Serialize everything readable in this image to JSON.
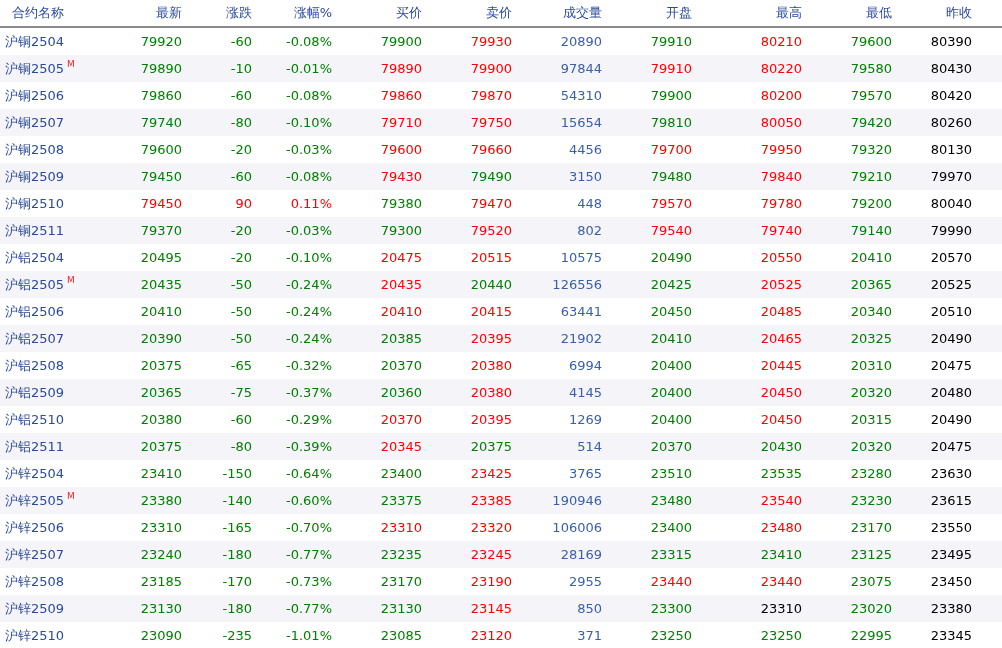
{
  "columns": [
    "合约名称",
    "最新",
    "涨跌",
    "涨幅%",
    "买价",
    "卖价",
    "成交量",
    "开盘",
    "最高",
    "最低",
    "昨收"
  ],
  "rows": [
    {
      "name": "沪铜2504",
      "cells": [
        {
          "text": "79920",
          "color": "#008000"
        },
        {
          "text": "-60",
          "color": "#008000"
        },
        {
          "text": "-0.08%",
          "color": "#008000"
        },
        {
          "text": "79900",
          "color": "#008000"
        },
        {
          "text": "79930",
          "color": "#ff0000"
        },
        {
          "text": "20890"
        },
        {
          "text": "79910",
          "color": "#008000"
        },
        {
          "text": "80210",
          "color": "#ff0000"
        },
        {
          "text": "79600",
          "color": "#008000"
        },
        {
          "text": "80390",
          "color": "#000000"
        }
      ]
    },
    {
      "name": "沪铜2505",
      "badge": "M",
      "cells": [
        {
          "text": "79890",
          "color": "#008000"
        },
        {
          "text": "-10",
          "color": "#008000"
        },
        {
          "text": "-0.01%",
          "color": "#008000"
        },
        {
          "text": "79890",
          "color": "#ff0000"
        },
        {
          "text": "79900",
          "color": "#ff0000"
        },
        {
          "text": "97844"
        },
        {
          "text": "79910",
          "color": "#ff0000"
        },
        {
          "text": "80220",
          "color": "#ff0000"
        },
        {
          "text": "79580",
          "color": "#008000"
        },
        {
          "text": "80430",
          "color": "#000000"
        }
      ]
    },
    {
      "name": "沪铜2506",
      "cells": [
        {
          "text": "79860",
          "color": "#008000"
        },
        {
          "text": "-60",
          "color": "#008000"
        },
        {
          "text": "-0.08%",
          "color": "#008000"
        },
        {
          "text": "79860",
          "color": "#ff0000"
        },
        {
          "text": "79870",
          "color": "#ff0000"
        },
        {
          "text": "54310"
        },
        {
          "text": "79900",
          "color": "#008000"
        },
        {
          "text": "80200",
          "color": "#ff0000"
        },
        {
          "text": "79570",
          "color": "#008000"
        },
        {
          "text": "80420",
          "color": "#000000"
        }
      ]
    },
    {
      "name": "沪铜2507",
      "cells": [
        {
          "text": "79740",
          "color": "#008000"
        },
        {
          "text": "-80",
          "color": "#008000"
        },
        {
          "text": "-0.10%",
          "color": "#008000"
        },
        {
          "text": "79710",
          "color": "#ff0000"
        },
        {
          "text": "79750",
          "color": "#ff0000"
        },
        {
          "text": "15654"
        },
        {
          "text": "79810",
          "color": "#008000"
        },
        {
          "text": "80050",
          "color": "#ff0000"
        },
        {
          "text": "79420",
          "color": "#008000"
        },
        {
          "text": "80260",
          "color": "#000000"
        }
      ]
    },
    {
      "name": "沪铜2508",
      "cells": [
        {
          "text": "79600",
          "color": "#008000"
        },
        {
          "text": "-20",
          "color": "#008000"
        },
        {
          "text": "-0.03%",
          "color": "#008000"
        },
        {
          "text": "79600",
          "color": "#ff0000"
        },
        {
          "text": "79660",
          "color": "#ff0000"
        },
        {
          "text": "4456"
        },
        {
          "text": "79700",
          "color": "#ff0000"
        },
        {
          "text": "79950",
          "color": "#ff0000"
        },
        {
          "text": "79320",
          "color": "#008000"
        },
        {
          "text": "80130",
          "color": "#000000"
        }
      ]
    },
    {
      "name": "沪铜2509",
      "cells": [
        {
          "text": "79450",
          "color": "#008000"
        },
        {
          "text": "-60",
          "color": "#008000"
        },
        {
          "text": "-0.08%",
          "color": "#008000"
        },
        {
          "text": "79430",
          "color": "#ff0000"
        },
        {
          "text": "79490",
          "color": "#008000"
        },
        {
          "text": "3150"
        },
        {
          "text": "79480",
          "color": "#008000"
        },
        {
          "text": "79840",
          "color": "#ff0000"
        },
        {
          "text": "79210",
          "color": "#008000"
        },
        {
          "text": "79970",
          "color": "#000000"
        }
      ]
    },
    {
      "name": "沪铜2510",
      "cells": [
        {
          "text": "79450",
          "color": "#ff0000"
        },
        {
          "text": "90",
          "color": "#ff0000"
        },
        {
          "text": "0.11%",
          "color": "#ff0000"
        },
        {
          "text": "79380",
          "color": "#008000"
        },
        {
          "text": "79470",
          "color": "#ff0000"
        },
        {
          "text": "448"
        },
        {
          "text": "79570",
          "color": "#ff0000"
        },
        {
          "text": "79780",
          "color": "#ff0000"
        },
        {
          "text": "79200",
          "color": "#008000"
        },
        {
          "text": "80040",
          "color": "#000000"
        }
      ]
    },
    {
      "name": "沪铜2511",
      "cells": [
        {
          "text": "79370",
          "color": "#008000"
        },
        {
          "text": "-20",
          "color": "#008000"
        },
        {
          "text": "-0.03%",
          "color": "#008000"
        },
        {
          "text": "79300",
          "color": "#008000"
        },
        {
          "text": "79520",
          "color": "#ff0000"
        },
        {
          "text": "802"
        },
        {
          "text": "79540",
          "color": "#ff0000"
        },
        {
          "text": "79740",
          "color": "#ff0000"
        },
        {
          "text": "79140",
          "color": "#008000"
        },
        {
          "text": "79990",
          "color": "#000000"
        }
      ]
    },
    {
      "name": "沪铝2504",
      "cells": [
        {
          "text": "20495",
          "color": "#008000"
        },
        {
          "text": "-20",
          "color": "#008000"
        },
        {
          "text": "-0.10%",
          "color": "#008000"
        },
        {
          "text": "20475",
          "color": "#ff0000"
        },
        {
          "text": "20515",
          "color": "#ff0000"
        },
        {
          "text": "10575"
        },
        {
          "text": "20490",
          "color": "#008000"
        },
        {
          "text": "20550",
          "color": "#ff0000"
        },
        {
          "text": "20410",
          "color": "#008000"
        },
        {
          "text": "20570",
          "color": "#000000"
        }
      ]
    },
    {
      "name": "沪铝2505",
      "badge": "M",
      "cells": [
        {
          "text": "20435",
          "color": "#008000"
        },
        {
          "text": "-50",
          "color": "#008000"
        },
        {
          "text": "-0.24%",
          "color": "#008000"
        },
        {
          "text": "20435",
          "color": "#ff0000"
        },
        {
          "text": "20440",
          "color": "#008000"
        },
        {
          "text": "126556"
        },
        {
          "text": "20425",
          "color": "#008000"
        },
        {
          "text": "20525",
          "color": "#ff0000"
        },
        {
          "text": "20365",
          "color": "#008000"
        },
        {
          "text": "20525",
          "color": "#000000"
        }
      ]
    },
    {
      "name": "沪铝2506",
      "cells": [
        {
          "text": "20410",
          "color": "#008000"
        },
        {
          "text": "-50",
          "color": "#008000"
        },
        {
          "text": "-0.24%",
          "color": "#008000"
        },
        {
          "text": "20410",
          "color": "#ff0000"
        },
        {
          "text": "20415",
          "color": "#ff0000"
        },
        {
          "text": "63441"
        },
        {
          "text": "20450",
          "color": "#008000"
        },
        {
          "text": "20485",
          "color": "#ff0000"
        },
        {
          "text": "20340",
          "color": "#008000"
        },
        {
          "text": "20510",
          "color": "#000000"
        }
      ]
    },
    {
      "name": "沪铝2507",
      "cells": [
        {
          "text": "20390",
          "color": "#008000"
        },
        {
          "text": "-50",
          "color": "#008000"
        },
        {
          "text": "-0.24%",
          "color": "#008000"
        },
        {
          "text": "20385",
          "color": "#008000"
        },
        {
          "text": "20395",
          "color": "#ff0000"
        },
        {
          "text": "21902"
        },
        {
          "text": "20410",
          "color": "#008000"
        },
        {
          "text": "20465",
          "color": "#ff0000"
        },
        {
          "text": "20325",
          "color": "#008000"
        },
        {
          "text": "20490",
          "color": "#000000"
        }
      ]
    },
    {
      "name": "沪铝2508",
      "cells": [
        {
          "text": "20375",
          "color": "#008000"
        },
        {
          "text": "-65",
          "color": "#008000"
        },
        {
          "text": "-0.32%",
          "color": "#008000"
        },
        {
          "text": "20370",
          "color": "#008000"
        },
        {
          "text": "20380",
          "color": "#ff0000"
        },
        {
          "text": "6994"
        },
        {
          "text": "20400",
          "color": "#008000"
        },
        {
          "text": "20445",
          "color": "#ff0000"
        },
        {
          "text": "20310",
          "color": "#008000"
        },
        {
          "text": "20475",
          "color": "#000000"
        }
      ]
    },
    {
      "name": "沪铝2509",
      "cells": [
        {
          "text": "20365",
          "color": "#008000"
        },
        {
          "text": "-75",
          "color": "#008000"
        },
        {
          "text": "-0.37%",
          "color": "#008000"
        },
        {
          "text": "20360",
          "color": "#008000"
        },
        {
          "text": "20380",
          "color": "#ff0000"
        },
        {
          "text": "4145"
        },
        {
          "text": "20400",
          "color": "#008000"
        },
        {
          "text": "20450",
          "color": "#ff0000"
        },
        {
          "text": "20320",
          "color": "#008000"
        },
        {
          "text": "20480",
          "color": "#000000"
        }
      ]
    },
    {
      "name": "沪铝2510",
      "cells": [
        {
          "text": "20380",
          "color": "#008000"
        },
        {
          "text": "-60",
          "color": "#008000"
        },
        {
          "text": "-0.29%",
          "color": "#008000"
        },
        {
          "text": "20370",
          "color": "#ff0000"
        },
        {
          "text": "20395",
          "color": "#ff0000"
        },
        {
          "text": "1269"
        },
        {
          "text": "20400",
          "color": "#008000"
        },
        {
          "text": "20450",
          "color": "#ff0000"
        },
        {
          "text": "20315",
          "color": "#008000"
        },
        {
          "text": "20490",
          "color": "#000000"
        }
      ]
    },
    {
      "name": "沪铝2511",
      "cells": [
        {
          "text": "20375",
          "color": "#008000"
        },
        {
          "text": "-80",
          "color": "#008000"
        },
        {
          "text": "-0.39%",
          "color": "#008000"
        },
        {
          "text": "20345",
          "color": "#ff0000"
        },
        {
          "text": "20375",
          "color": "#008000"
        },
        {
          "text": "514"
        },
        {
          "text": "20370",
          "color": "#008000"
        },
        {
          "text": "20430",
          "color": "#008000"
        },
        {
          "text": "20320",
          "color": "#008000"
        },
        {
          "text": "20475",
          "color": "#000000"
        }
      ]
    },
    {
      "name": "沪锌2504",
      "cells": [
        {
          "text": "23410",
          "color": "#008000"
        },
        {
          "text": "-150",
          "color": "#008000"
        },
        {
          "text": "-0.64%",
          "color": "#008000"
        },
        {
          "text": "23400",
          "color": "#008000"
        },
        {
          "text": "23425",
          "color": "#ff0000"
        },
        {
          "text": "3765"
        },
        {
          "text": "23510",
          "color": "#008000"
        },
        {
          "text": "23535",
          "color": "#008000"
        },
        {
          "text": "23280",
          "color": "#008000"
        },
        {
          "text": "23630",
          "color": "#000000"
        }
      ]
    },
    {
      "name": "沪锌2505",
      "badge": "M",
      "cells": [
        {
          "text": "23380",
          "color": "#008000"
        },
        {
          "text": "-140",
          "color": "#008000"
        },
        {
          "text": "-0.60%",
          "color": "#008000"
        },
        {
          "text": "23375",
          "color": "#008000"
        },
        {
          "text": "23385",
          "color": "#ff0000"
        },
        {
          "text": "190946"
        },
        {
          "text": "23480",
          "color": "#008000"
        },
        {
          "text": "23540",
          "color": "#ff0000"
        },
        {
          "text": "23230",
          "color": "#008000"
        },
        {
          "text": "23615",
          "color": "#000000"
        }
      ]
    },
    {
      "name": "沪锌2506",
      "cells": [
        {
          "text": "23310",
          "color": "#008000"
        },
        {
          "text": "-165",
          "color": "#008000"
        },
        {
          "text": "-0.70%",
          "color": "#008000"
        },
        {
          "text": "23310",
          "color": "#ff0000"
        },
        {
          "text": "23320",
          "color": "#ff0000"
        },
        {
          "text": "106006"
        },
        {
          "text": "23400",
          "color": "#008000"
        },
        {
          "text": "23480",
          "color": "#ff0000"
        },
        {
          "text": "23170",
          "color": "#008000"
        },
        {
          "text": "23550",
          "color": "#000000"
        }
      ]
    },
    {
      "name": "沪锌2507",
      "cells": [
        {
          "text": "23240",
          "color": "#008000"
        },
        {
          "text": "-180",
          "color": "#008000"
        },
        {
          "text": "-0.77%",
          "color": "#008000"
        },
        {
          "text": "23235",
          "color": "#008000"
        },
        {
          "text": "23245",
          "color": "#ff0000"
        },
        {
          "text": "28169"
        },
        {
          "text": "23315",
          "color": "#008000"
        },
        {
          "text": "23410",
          "color": "#008000"
        },
        {
          "text": "23125",
          "color": "#008000"
        },
        {
          "text": "23495",
          "color": "#000000"
        }
      ]
    },
    {
      "name": "沪锌2508",
      "cells": [
        {
          "text": "23185",
          "color": "#008000"
        },
        {
          "text": "-170",
          "color": "#008000"
        },
        {
          "text": "-0.73%",
          "color": "#008000"
        },
        {
          "text": "23170",
          "color": "#008000"
        },
        {
          "text": "23190",
          "color": "#ff0000"
        },
        {
          "text": "2955"
        },
        {
          "text": "23440",
          "color": "#ff0000"
        },
        {
          "text": "23440",
          "color": "#ff0000"
        },
        {
          "text": "23075",
          "color": "#008000"
        },
        {
          "text": "23450",
          "color": "#000000"
        }
      ]
    },
    {
      "name": "沪锌2509",
      "cells": [
        {
          "text": "23130",
          "color": "#008000"
        },
        {
          "text": "-180",
          "color": "#008000"
        },
        {
          "text": "-0.77%",
          "color": "#008000"
        },
        {
          "text": "23130",
          "color": "#008000"
        },
        {
          "text": "23145",
          "color": "#ff0000"
        },
        {
          "text": "850"
        },
        {
          "text": "23300",
          "color": "#008000"
        },
        {
          "text": "23310",
          "color": "#000000"
        },
        {
          "text": "23020",
          "color": "#008000"
        },
        {
          "text": "23380",
          "color": "#000000"
        }
      ]
    },
    {
      "name": "沪锌2510",
      "cells": [
        {
          "text": "23090",
          "color": "#008000"
        },
        {
          "text": "-235",
          "color": "#008000"
        },
        {
          "text": "-1.01%",
          "color": "#008000"
        },
        {
          "text": "23085",
          "color": "#008000"
        },
        {
          "text": "23120",
          "color": "#ff0000"
        },
        {
          "text": "371"
        },
        {
          "text": "23250",
          "color": "#008000"
        },
        {
          "text": "23250",
          "color": "#008000"
        },
        {
          "text": "22995",
          "color": "#008000"
        },
        {
          "text": "23345",
          "color": "#000000"
        }
      ]
    }
  ]
}
